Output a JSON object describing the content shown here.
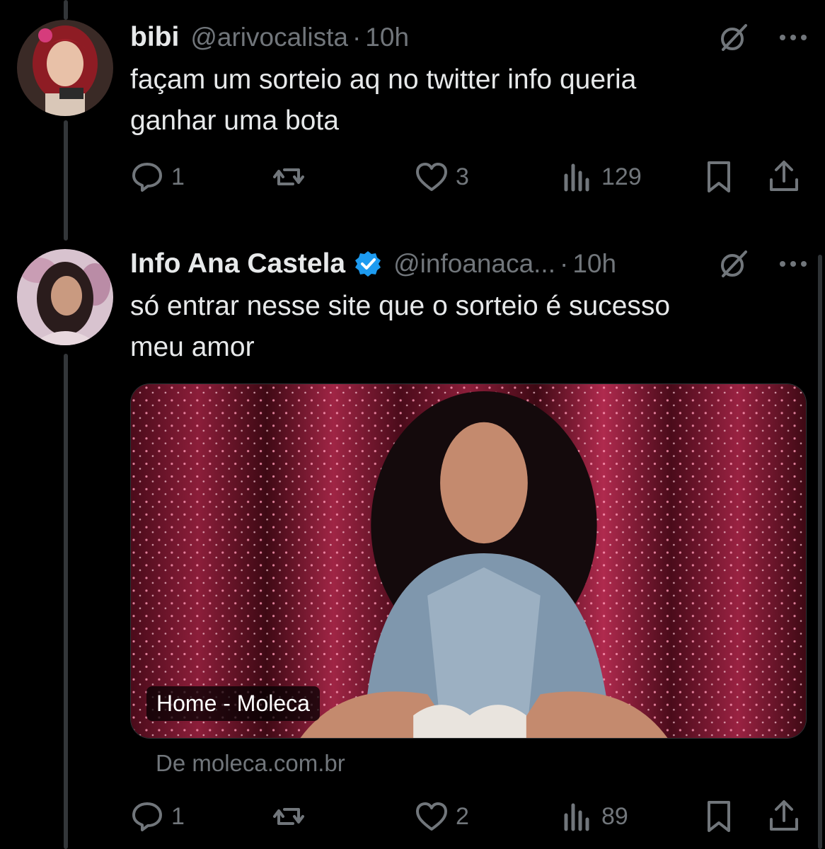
{
  "colors": {
    "background": "#000000",
    "text": "#e7e9ea",
    "muted": "#71767b",
    "verified": "#1d9bf0"
  },
  "tweets": [
    {
      "name": "bibi",
      "verified": false,
      "handle": "@arivocalista",
      "separator": "·",
      "time": "10h",
      "text": "façam um sorteio aq no twitter info queria\nganhar uma bota",
      "stats": {
        "replies": "1",
        "retweets": "",
        "likes": "3",
        "views": "129"
      },
      "icons": [
        "grok-icon",
        "more-icon",
        "reply-icon",
        "retweet-icon",
        "like-icon",
        "views-icon",
        "bookmark-icon",
        "share-icon"
      ]
    },
    {
      "name": "Info Ana Castela",
      "verified": true,
      "handle": "@infoanaca...",
      "separator": "·",
      "time": "10h",
      "text": "só entrar nesse site que o sorteio é sucesso\nmeu amor",
      "card": {
        "title": "Home - Moleca",
        "source": "De moleca.com.br"
      },
      "stats": {
        "replies": "1",
        "retweets": "",
        "likes": "2",
        "views": "89"
      },
      "icons": [
        "verified-badge-icon",
        "grok-icon",
        "more-icon",
        "reply-icon",
        "retweet-icon",
        "like-icon",
        "views-icon",
        "bookmark-icon",
        "share-icon"
      ]
    }
  ]
}
